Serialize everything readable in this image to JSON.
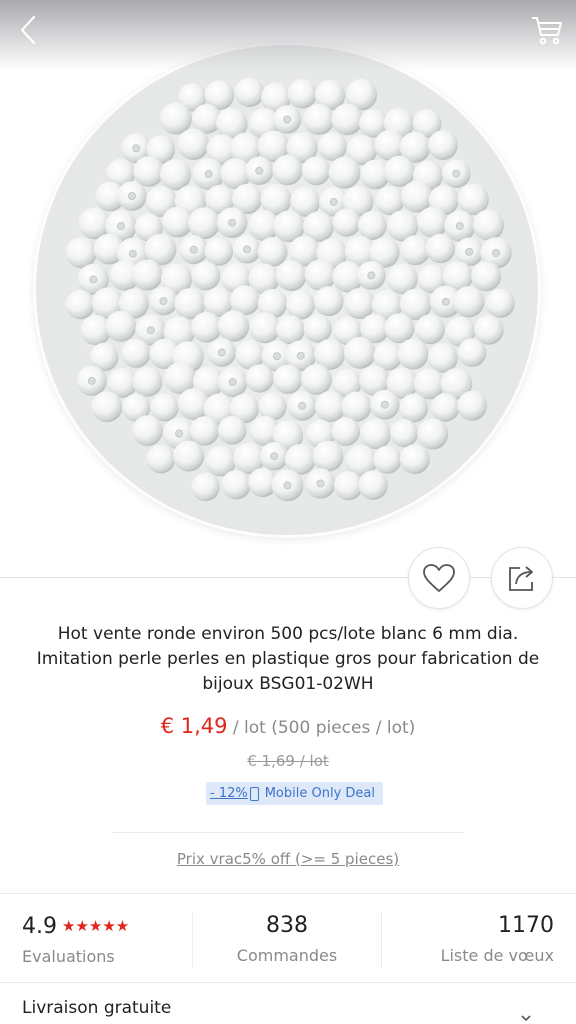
{
  "product": {
    "title": "Hot vente ronde environ 500 pcs/lote blanc 6 mm dia. Imitation perle perles en plastique gros pour fabrication de bijoux BSG01-02WH",
    "price": "€ 1,49",
    "unit": " / lot (500 pieces / lot)",
    "old_price": "€ 1,69 / lot",
    "discount": "- 12%",
    "deal_label": "Mobile Only Deal",
    "bulk_price": "Prix vrac5% off (>= 5 pieces)"
  },
  "stats": {
    "rating": "4.9",
    "rating_stars": 5,
    "stars_text": "★★★★★",
    "rating_label": "Evaluations",
    "orders": "838",
    "orders_label": "Commandes",
    "wishlist": "1170",
    "wishlist_label": "Liste de vœux"
  },
  "shipping": {
    "label": "Livraison gratuite"
  },
  "icons": {
    "back": "chevron-left-icon",
    "cart": "cart-icon",
    "wishlist": "heart-icon",
    "share": "share-icon",
    "phone": "phone-icon",
    "chevron": "chevron-down-icon"
  },
  "colors": {
    "accent": "#e1251b",
    "deal_bg": "#dde8f8",
    "deal_text": "#3f73c9",
    "muted": "#8a8a8a"
  }
}
